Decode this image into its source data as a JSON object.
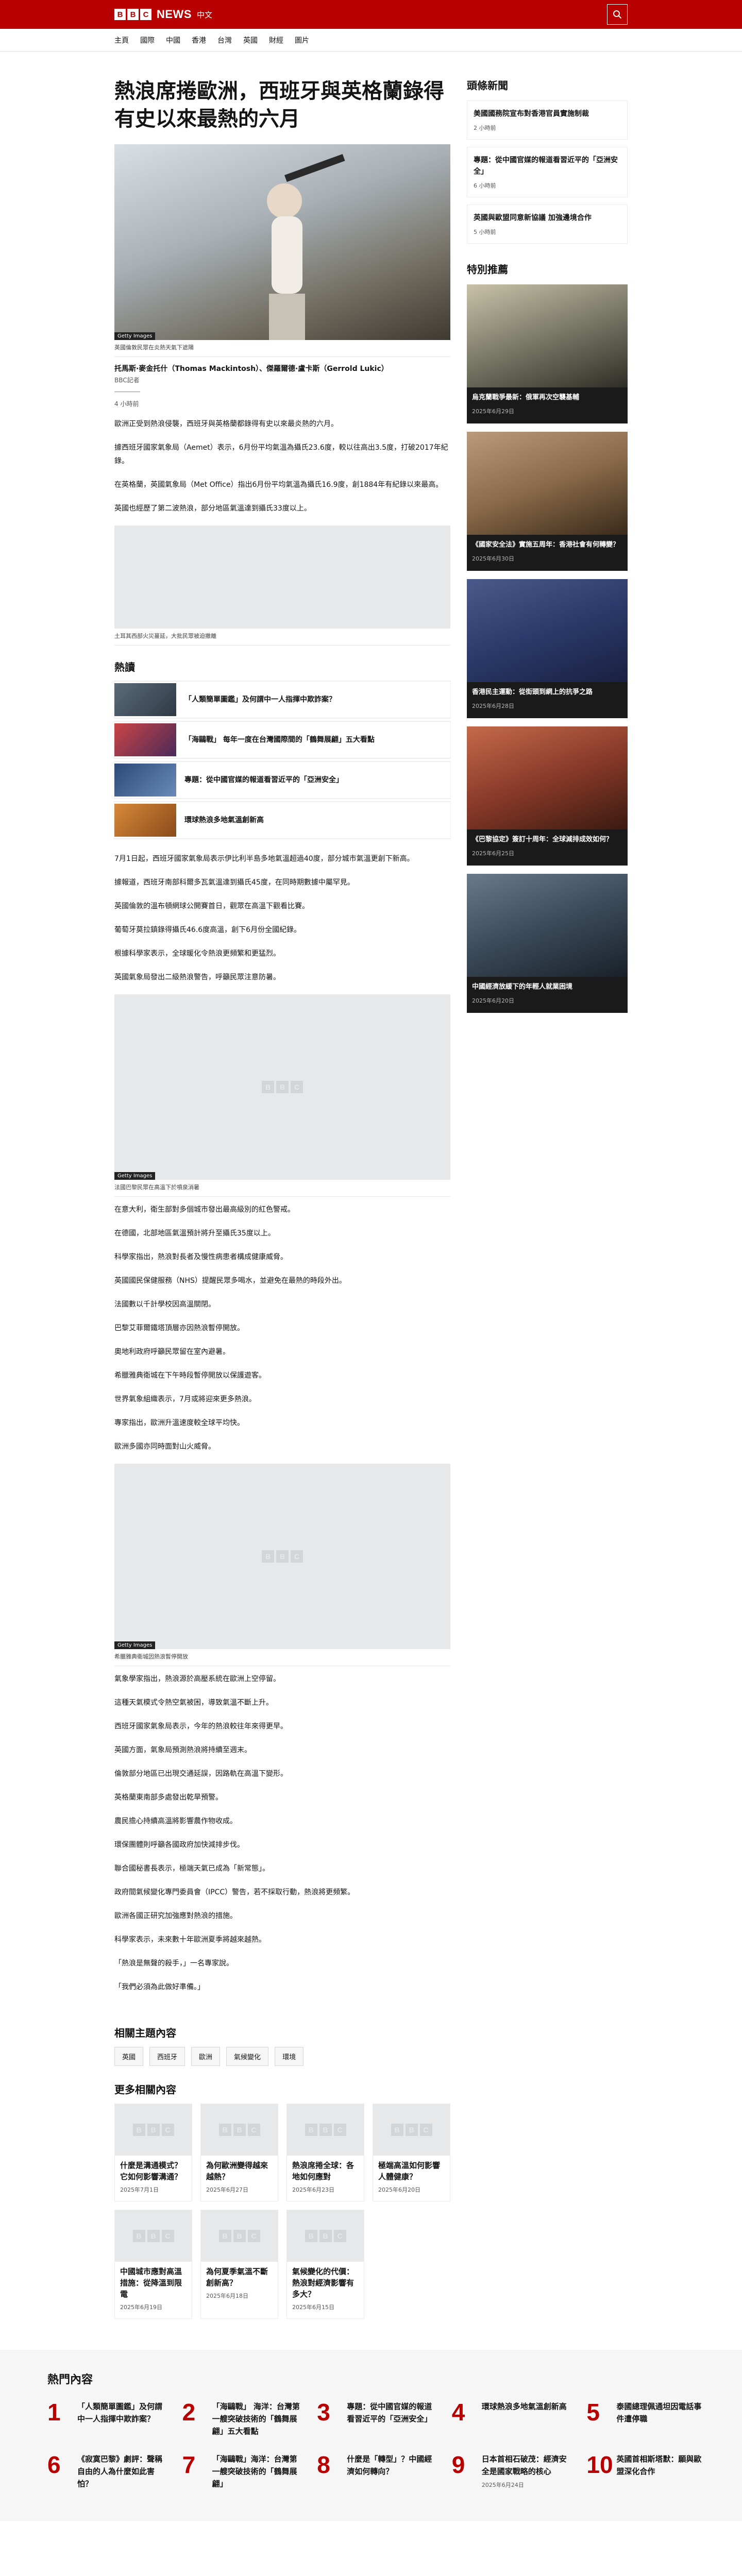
{
  "header": {
    "brand_letters": [
      "B",
      "B",
      "C"
    ],
    "brand_news": "NEWS",
    "brand_lang": "中文",
    "nav": [
      "主頁",
      "國際",
      "中國",
      "香港",
      "台灣",
      "英國",
      "財經",
      "圖片"
    ]
  },
  "article": {
    "headline": "熱浪席捲歐洲，西班牙與英格蘭錄得有史以來最熱的六月",
    "hero_caption": "英國倫敦民眾在炎熱天氣下遮陽",
    "hero_credit": "Getty Images",
    "author": "托馬斯·麥金托什（Thomas Mackintosh）、傑羅爾德·盧卡斯（Gerrold Lukic）",
    "author_role": "BBC記者",
    "time": "4 小時前",
    "paragraphs_a": [
      "歐洲正受到熱浪侵襲，西班牙與英格蘭都錄得有史以來最炎熱的六月。",
      "據西班牙國家氣象局（Aemet）表示，6月份平均氣溫為攝氏23.6度，較以往高出3.5度，打破2017年紀錄。",
      "在英格蘭，英國氣象局（Met Office）指出6月份平均氣溫為攝氏16.9度，創1884年有紀錄以來最高。",
      "英國也經歷了第二波熱浪，部分地區氣溫達到攝氏33度以上。"
    ],
    "inline_caption_1": "土耳其西部火災蔓延，大批民眾被迫撤離",
    "hot_section_title": "熱讀",
    "hot_items": [
      "「人類簡單圖鑑」及何謂中一人指揮中欺詐案？",
      "「海鷗戰」 每年一度在台灣國際間的「鶴舞展翩」五大看點",
      "專題：從中國官媒的報道看習近平的「亞洲安全」",
      "環球熱浪多地氣溫創新高"
    ],
    "paragraphs_b": [
      "7月1日起，西班牙國家氣象局表示伊比利半島多地氣溫超過40度，部分城市氣溫更創下新高。",
      "據報道，西班牙南部科爾多瓦氣溫達到攝氏45度，在同時期數據中屬罕見。",
      "英國倫敦的溫布頓網球公開賽首日，觀眾在高溫下觀看比賽。",
      "葡萄牙莫拉鎮錄得攝氏46.6度高溫，創下6月份全國紀錄。",
      "根據科學家表示，全球暖化令熱浪更頻繁和更猛烈。",
      "英國氣象局發出二級熱浪警告，呼籲民眾注意防暑。"
    ],
    "inline_caption_2": "法國巴黎民眾在高溫下於噴泉消暑",
    "paragraphs_c": [
      "在意大利，衛生部對多個城市發出最高級別的紅色警戒。",
      "在德國，北部地區氣溫預計將升至攝氏35度以上。",
      "科學家指出，熱浪對長者及慢性病患者構成健康威脅。",
      "英國國民保健服務（NHS）提醒民眾多喝水，並避免在最熱的時段外出。",
      "法國數以千計學校因高溫關閉。",
      "巴黎艾菲爾鐵塔頂層亦因熱浪暫停開放。",
      "奧地利政府呼籲民眾留在室內避暑。",
      "希臘雅典衛城在下午時段暫停開放以保護遊客。",
      "世界氣象組織表示，7月或將迎來更多熱浪。",
      "專家指出，歐洲升溫速度較全球平均快。",
      "歐洲多國亦同時面對山火威脅。"
    ],
    "inline_caption_3": "希臘雅典衛城因熱浪暫停開放",
    "paragraphs_d": [
      "氣象學家指出，熱浪源於高壓系統在歐洲上空停留。",
      "這種天氣模式令熱空氣被困，導致氣溫不斷上升。",
      "西班牙國家氣象局表示，今年的熱浪較往年來得更早。",
      "英國方面，氣象局預測熱浪將持續至週末。",
      "倫敦部分地區已出現交通延誤，因路軌在高溫下變形。",
      "英格蘭東南部多處發出乾旱預警。",
      "農民擔心持續高溫將影響農作物收成。",
      "環保團體則呼籲各國政府加快減排步伐。",
      "聯合國秘書長表示，極端天氣已成為「新常態」。",
      "政府間氣候變化專門委員會（IPCC）警告，若不採取行動，熱浪將更頻繁。",
      "歐洲各國正研究加強應對熱浪的措施。",
      "科學家表示，未來數十年歐洲夏季將越來越熱。",
      "「熱浪是無聲的殺手，」一名專家說。",
      "「我們必須為此做好準備。」"
    ]
  },
  "related": {
    "title": "相關主題內容",
    "tags": [
      "英國",
      "西班牙",
      "歐洲",
      "氣候變化",
      "環境"
    ]
  },
  "more": {
    "title": "更多相關內容",
    "items": [
      {
        "title": "什麼是溝通模式？它如何影響溝通？",
        "date": "2025年7月1日"
      },
      {
        "title": "為何歐洲變得越來越熱？",
        "date": "2025年6月27日"
      },
      {
        "title": "熱浪席捲全球：各地如何應對",
        "date": "2025年6月23日"
      },
      {
        "title": "極端高溫如何影響人體健康？",
        "date": "2025年6月20日"
      },
      {
        "title": "中國城市應對高溫措施：從降溫到限電",
        "date": "2025年6月19日"
      },
      {
        "title": "為何夏季氣溫不斷創新高？",
        "date": "2025年6月18日"
      },
      {
        "title": "氣候變化的代價：熱浪對經濟影響有多大？",
        "date": "2025年6月15日"
      }
    ]
  },
  "sidebar": {
    "top_title": "頭條新聞",
    "top_items": [
      {
        "title": "美國國務院宣布對香港官員實施制裁",
        "date": "2 小時前"
      },
      {
        "title": "專題：從中國官媒的報道看習近平的「亞洲安全」",
        "date": "6 小時前"
      },
      {
        "title": "英國與歐盟同意新協議 加強邊境合作",
        "date": "5 小時前"
      }
    ],
    "special_title": "特別推薦",
    "special_items": [
      {
        "title": "烏克蘭戰爭最新：俄軍再次空襲基輔",
        "date": "2025年6月29日"
      },
      {
        "title": "《國家安全法》實施五周年：香港社會有何轉變？",
        "date": "2025年6月30日"
      },
      {
        "title": "香港民主運動：從街頭到網上的抗爭之路",
        "date": "2025年6月28日"
      },
      {
        "title": "《巴黎協定》簽訂十周年：全球減排成效如何？",
        "date": "2025年6月25日"
      },
      {
        "title": "中國經濟放緩下的年輕人就業困境",
        "date": "2025年6月20日"
      }
    ]
  },
  "popular": {
    "title": "熱門內容",
    "items": [
      {
        "num": "1",
        "title": "「人類簡單圖鑑」及何謂中一人指揮中欺詐案？"
      },
      {
        "num": "2",
        "title": "「海鷗戰」 海洋：台灣第一艘突破技術的「鶴舞展翩」五大看點"
      },
      {
        "num": "3",
        "title": "專題：從中國官媒的報道看習近平的「亞洲安全」"
      },
      {
        "num": "4",
        "title": "環球熱浪多地氣溫創新高"
      },
      {
        "num": "5",
        "title": "泰國總理佩通坦因電話事件遭停職"
      },
      {
        "num": "6",
        "title": "《寂寞巴黎》劇評：聲稱自由的人為什麼如此害怕？"
      },
      {
        "num": "7",
        "title": "「海鷗戰」海洋：台灣第一艘突破技術的「鶴舞展翩」"
      },
      {
        "num": "8",
        "title": "什麼是「轉型」？中國經濟如何轉向？"
      },
      {
        "num": "9",
        "title": "日本首相石破茂：經濟安全是國家戰略的核心",
        "date": "2025年6月24日"
      },
      {
        "num": "10",
        "title": "英國首相斯塔默：願與歐盟深化合作"
      }
    ]
  },
  "colors": {
    "brand": "#b80000",
    "text": "#141414",
    "muted": "#545658"
  }
}
